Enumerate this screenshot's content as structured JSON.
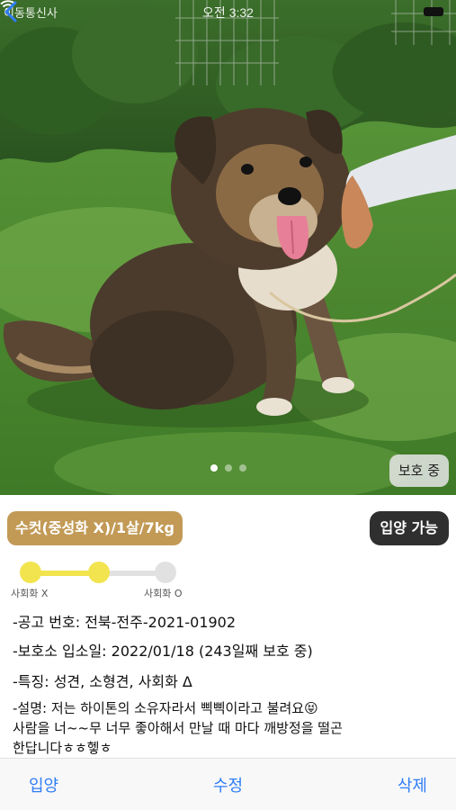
{
  "status_bar": {
    "carrier": "이동통신사",
    "time": "오전 3:32"
  },
  "photo": {
    "pages_count": 3,
    "active_page": 1,
    "status_chip": "보호 중"
  },
  "pet": {
    "summary": "수컷(중성화 X)/1살/7kg",
    "adoption_status": "입양 가능",
    "socialization": {
      "level": 0.5,
      "label_low": "사회화 X",
      "label_high": "사회화 O"
    },
    "notice_no": "-공고 번호: 전북-전주-2021-01902",
    "intake_date": "-보호소 입소일: 2022/01/18 (243일째 보호 중)",
    "features": "-특징: 성견, 소형견, 사회화 Δ",
    "description_line1": "-설명: 저는 하이톤의 소유자라서 삑삑이라고 불려요😝",
    "description_line2": "사람을 너~~무 너무 좋아해서 만날 때 마다 깨방정을 떨곤",
    "description_line3": "한답니다ㅎㅎ헿ㅎ"
  },
  "toolbar": {
    "adopt_label": "입양",
    "edit_label": "수정",
    "delete_label": "삭제"
  },
  "colors": {
    "summary_badge": "#c29a56",
    "adopt_badge": "#2f2f2f",
    "social_active": "#f2e44e",
    "toolbar_text": "#2f7df6"
  }
}
